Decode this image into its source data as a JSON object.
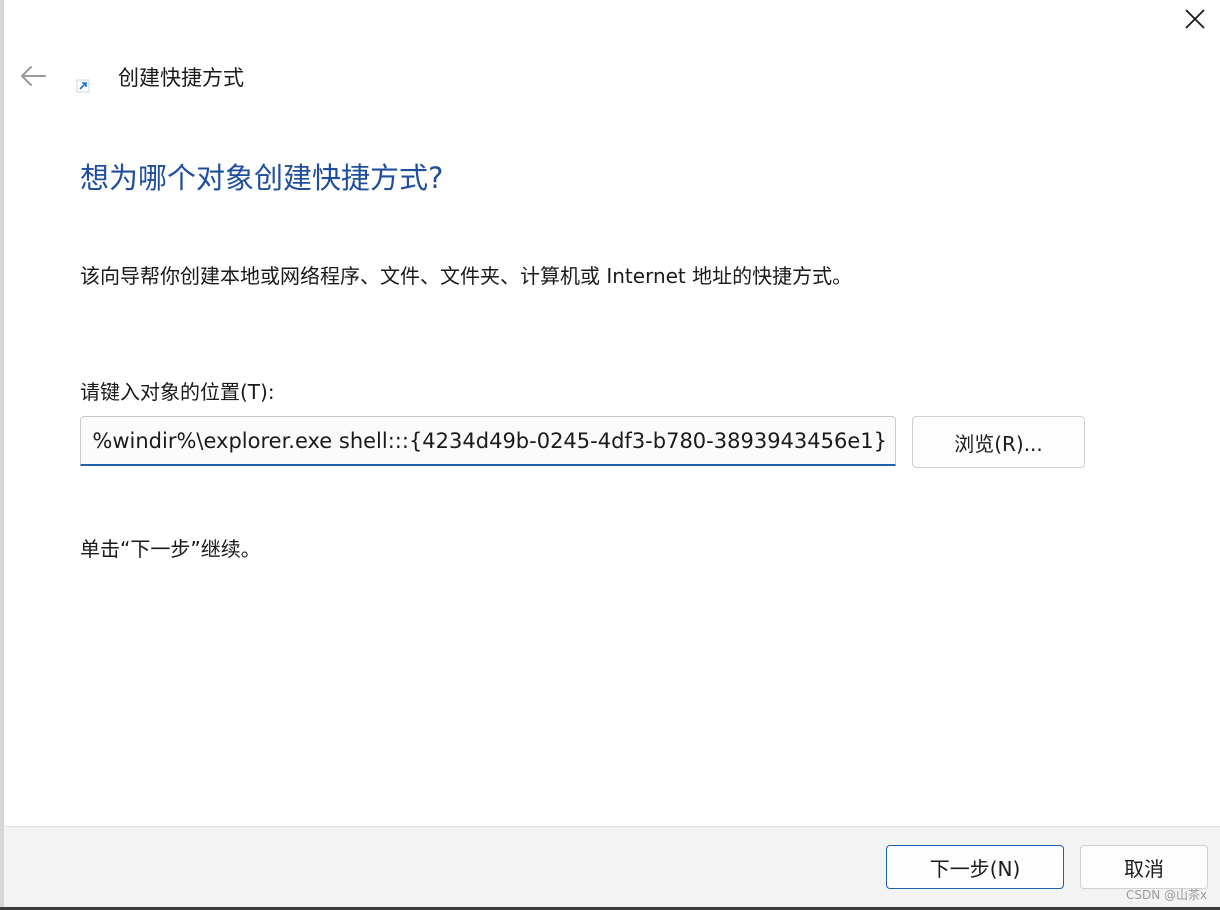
{
  "window": {
    "title": "创建快捷方式",
    "close_icon": "close-icon",
    "back_icon": "back-arrow-icon",
    "app_icon": "shortcut-icon"
  },
  "page": {
    "heading": "想为哪个对象创建快捷方式?",
    "description": "该向导帮你创建本地或网络程序、文件、文件夹、计算机或 Internet 地址的快捷方式。",
    "location_label": "请键入对象的位置(T):",
    "location_value": "%windir%\\explorer.exe shell:::{4234d49b-0245-4df3-b780-3893943456e1}",
    "browse_label": "浏览(R)...",
    "instruction": "单击“下一步”继续。"
  },
  "footer": {
    "next_label": "下一步(N)",
    "cancel_label": "取消"
  },
  "watermark": "CSDN @山茶x",
  "colors": {
    "accent": "#1f4e9c",
    "focus": "#1f5fb0",
    "footer_bg": "#f3f3f3"
  }
}
